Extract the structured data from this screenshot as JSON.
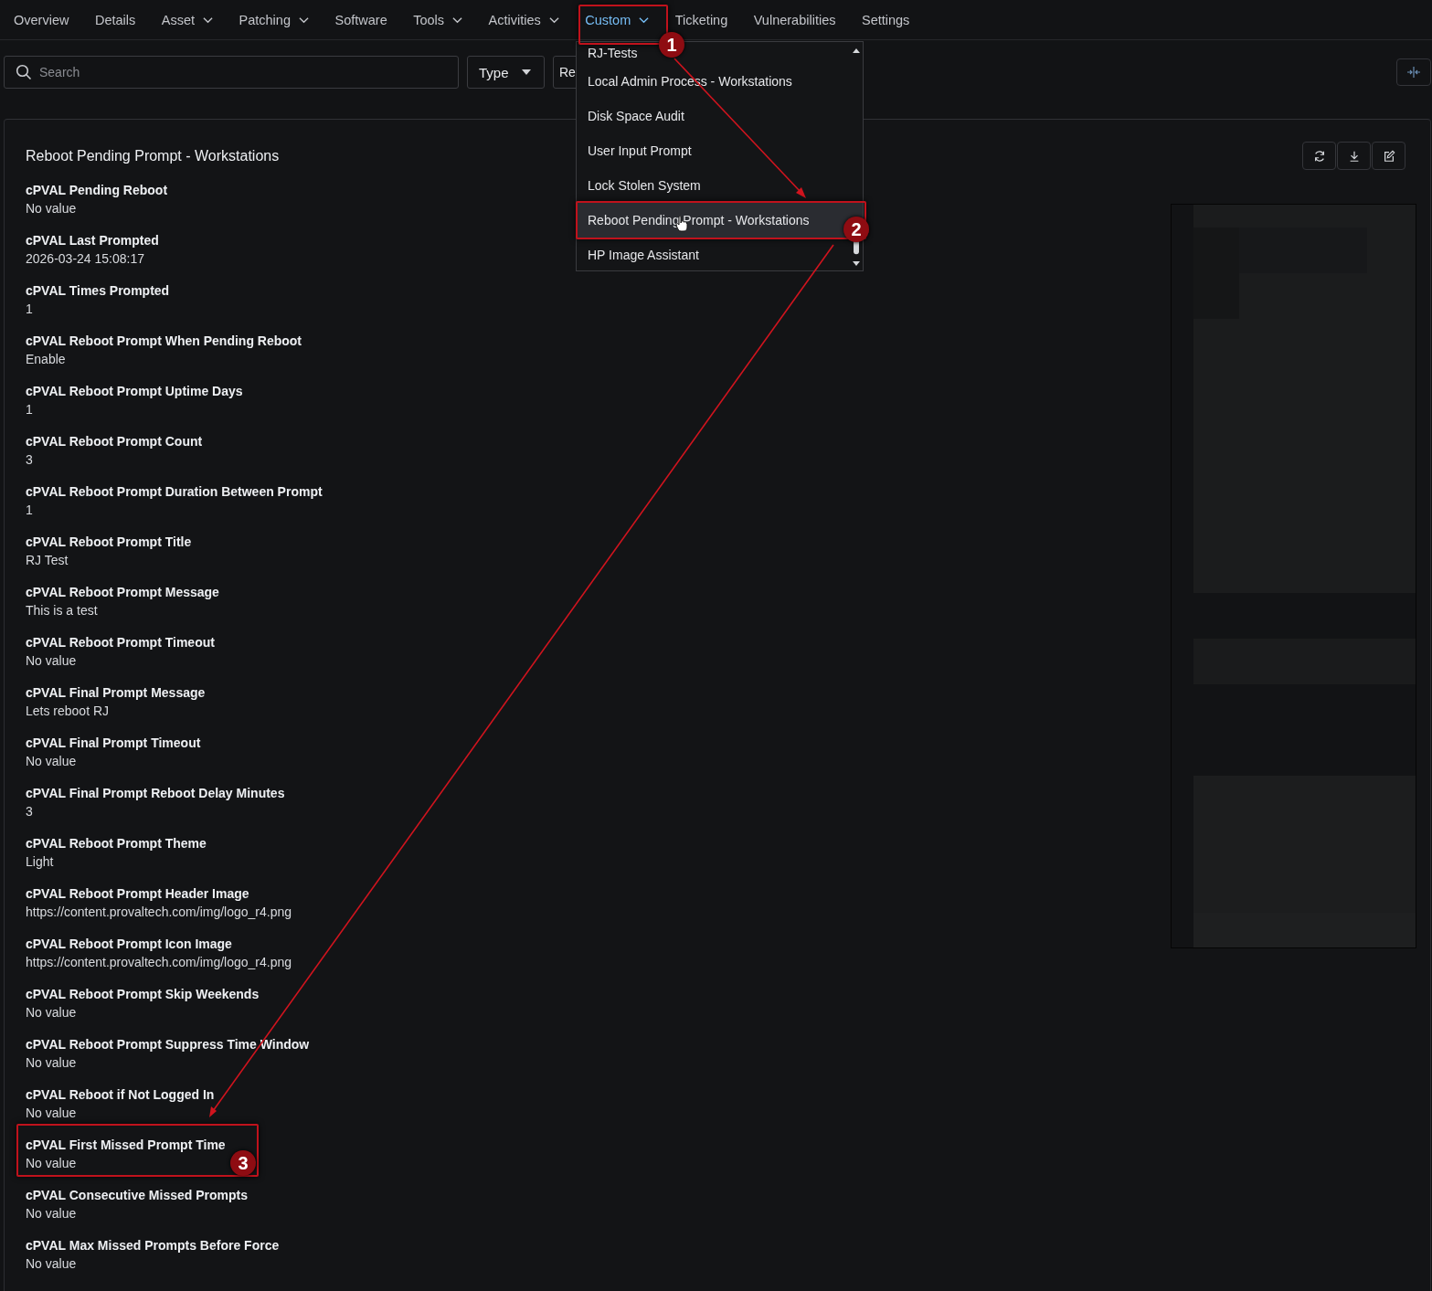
{
  "nav": {
    "tabs": [
      {
        "label": "Overview",
        "has_menu": false,
        "selected": false
      },
      {
        "label": "Details",
        "has_menu": false,
        "selected": false
      },
      {
        "label": "Asset",
        "has_menu": true,
        "selected": false
      },
      {
        "label": "Patching",
        "has_menu": true,
        "selected": false
      },
      {
        "label": "Software",
        "has_menu": false,
        "selected": false
      },
      {
        "label": "Tools",
        "has_menu": true,
        "selected": false
      },
      {
        "label": "Activities",
        "has_menu": true,
        "selected": false
      },
      {
        "label": "Custom",
        "has_menu": true,
        "selected": true
      },
      {
        "label": "Ticketing",
        "has_menu": false,
        "selected": false
      },
      {
        "label": "Vulnerabilities",
        "has_menu": false,
        "selected": false
      },
      {
        "label": "Settings",
        "has_menu": false,
        "selected": false
      }
    ]
  },
  "toolbar": {
    "search": {
      "placeholder": "Search"
    },
    "type_button": "Type",
    "hidden_button": "Re"
  },
  "custom_menu": {
    "items": [
      {
        "label": "RJ-Tests",
        "selected": false
      },
      {
        "label": "Local Admin Process - Workstations",
        "selected": false
      },
      {
        "label": "Disk Space Audit",
        "selected": false
      },
      {
        "label": "User Input Prompt",
        "selected": false
      },
      {
        "label": "Lock Stolen System",
        "selected": false
      },
      {
        "label": "Reboot Pending Prompt - Workstations",
        "selected": true
      },
      {
        "label": "HP Image Assistant",
        "selected": false
      }
    ]
  },
  "panel": {
    "title": "Reboot Pending Prompt - Workstations",
    "fields": [
      {
        "label": "cPVAL Pending Reboot",
        "value": "No value"
      },
      {
        "label": "cPVAL Last Prompted",
        "value": "2026-03-24 15:08:17"
      },
      {
        "label": "cPVAL Times Prompted",
        "value": "1"
      },
      {
        "label": "cPVAL Reboot Prompt When Pending Reboot",
        "value": "Enable"
      },
      {
        "label": "cPVAL Reboot Prompt Uptime Days",
        "value": "1"
      },
      {
        "label": "cPVAL Reboot Prompt Count",
        "value": "3"
      },
      {
        "label": "cPVAL Reboot Prompt Duration Between Prompt",
        "value": "1"
      },
      {
        "label": "cPVAL Reboot Prompt Title",
        "value": "RJ Test"
      },
      {
        "label": "cPVAL Reboot Prompt Message",
        "value": "This is a test"
      },
      {
        "label": "cPVAL Reboot Prompt Timeout",
        "value": "No value"
      },
      {
        "label": "cPVAL Final Prompt Message",
        "value": "Lets reboot RJ"
      },
      {
        "label": "cPVAL Final Prompt Timeout",
        "value": "No value"
      },
      {
        "label": "cPVAL Final Prompt Reboot Delay Minutes",
        "value": "3"
      },
      {
        "label": "cPVAL Reboot Prompt Theme",
        "value": "Light"
      },
      {
        "label": "cPVAL Reboot Prompt Header Image",
        "value": "https://content.provaltech.com/img/logo_r4.png"
      },
      {
        "label": "cPVAL Reboot Prompt Icon Image",
        "value": "https://content.provaltech.com/img/logo_r4.png"
      },
      {
        "label": "cPVAL Reboot Prompt Skip Weekends",
        "value": "No value"
      },
      {
        "label": "cPVAL Reboot Prompt Suppress Time Window",
        "value": "No value"
      },
      {
        "label": "cPVAL Reboot if Not Logged In",
        "value": "No value"
      },
      {
        "label": "cPVAL First Missed Prompt Time",
        "value": "No value"
      },
      {
        "label": "cPVAL Consecutive Missed Prompts",
        "value": "No value"
      },
      {
        "label": "cPVAL Max Missed Prompts Before Force",
        "value": "No value"
      }
    ]
  },
  "annotations": [
    {
      "number": "1"
    },
    {
      "number": "2"
    },
    {
      "number": "3"
    }
  ]
}
